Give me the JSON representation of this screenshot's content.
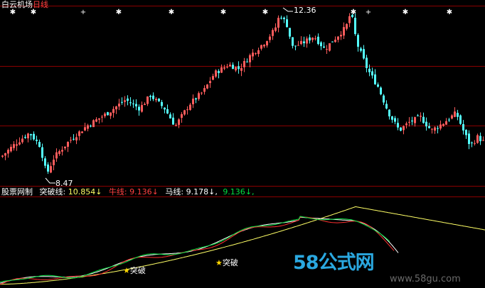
{
  "header": {
    "stock_name": "白云机场",
    "period": "日线"
  },
  "price_panel": {
    "high_label": "12.36",
    "low_label": "8.47"
  },
  "indicator_panel": {
    "name": "股票网制",
    "breakout_line": {
      "label": "突破线:",
      "value": "10.854",
      "arrow": "↓"
    },
    "bull_line": {
      "label": "牛线:",
      "value": "9.136",
      "arrow": "↓"
    },
    "horse_line": {
      "label": "马线:",
      "value": "9.178",
      "arrow": "↓"
    },
    "extra_line": {
      "value": "9.136",
      "arrow": "↓"
    },
    "signal_labels": [
      "突破",
      "突破"
    ]
  },
  "watermark": {
    "brand": "58公式网",
    "url": "www.58gu.com"
  },
  "colors": {
    "up": "#ff5c5c",
    "down": "#54ffff",
    "grid": "#8b0000",
    "yellow_line": "#ffff66",
    "white_line": "#ffffff",
    "red_line": "#ff3030",
    "green_line": "#00e040"
  },
  "chart_data": {
    "type": "candlestick",
    "title": "白云机场 日线",
    "price_range_visible": [
      8.47,
      12.36
    ],
    "annotations": [
      {
        "text": "12.36",
        "meaning": "period high"
      },
      {
        "text": "8.47",
        "meaning": "period low"
      }
    ],
    "indicator": {
      "type": "line",
      "series": [
        {
          "name": "突破线",
          "last_value": 10.854
        },
        {
          "name": "牛线",
          "last_value": 9.136
        },
        {
          "name": "马线",
          "last_value": 9.178
        },
        {
          "last_value": 9.136
        }
      ],
      "signals": [
        "突破",
        "突破"
      ]
    }
  }
}
